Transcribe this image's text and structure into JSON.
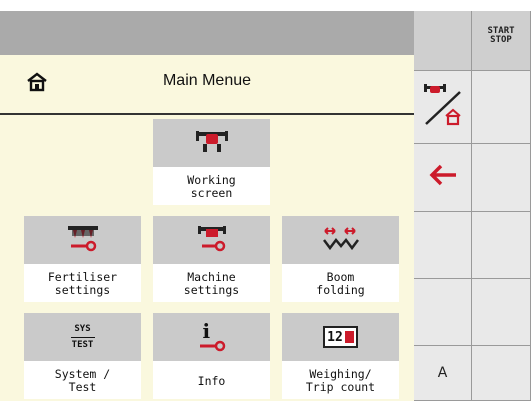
{
  "header": {
    "title": "Main Menue",
    "home_icon": "home-icon"
  },
  "tiles": [
    {
      "label": "Working\nscreen",
      "icon": "spreader-icon"
    },
    {
      "label": "Fertiliser\nsettings",
      "icon": "fertiliser-settings-icon"
    },
    {
      "label": "Machine\nsettings",
      "icon": "machine-settings-icon"
    },
    {
      "label": "Boom\nfolding",
      "icon": "boom-folding-icon"
    },
    {
      "label": "System /\nTest",
      "icon": "system-test-icon",
      "icon_text_top": "SYS",
      "icon_text_bottom": "TEST"
    },
    {
      "label": "Info",
      "icon": "info-icon",
      "icon_text": "i"
    },
    {
      "label": "Weighing/\nTrip count",
      "icon": "weighing-icon",
      "icon_text": "12"
    }
  ],
  "softkeys": {
    "start_stop": "START\nSTOP",
    "a_label": "A",
    "back_icon": "back-arrow-icon",
    "home_toggle_icon": "home-toggle-icon"
  },
  "colors": {
    "screen_bg": "#faf8de",
    "tile_icon_bg": "#cacaca",
    "accent_red": "#cc1b2b",
    "title_bar": "#aaaaaa"
  }
}
